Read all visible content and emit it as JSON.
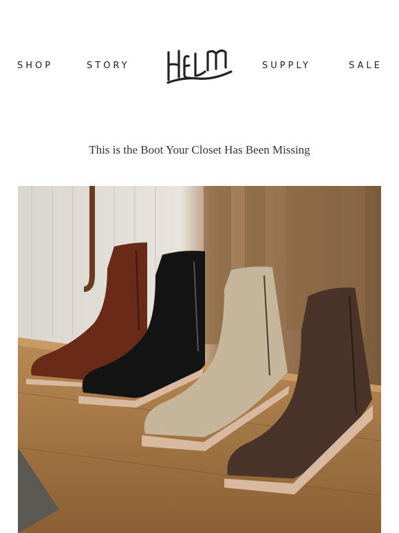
{
  "nav": {
    "shop": "SHOP",
    "story": "STORY",
    "supply": "SUPPLY",
    "sale": "SALE"
  },
  "logo": {
    "text": "HELM"
  },
  "headline": "This is the Boot Your Closet Has Been Missing",
  "hero": {
    "image": "four-chelsea-boots-on-wooden-bench",
    "boot_colors": [
      "#6a2a18",
      "#141414",
      "#c4b59b",
      "#4a3329"
    ]
  }
}
